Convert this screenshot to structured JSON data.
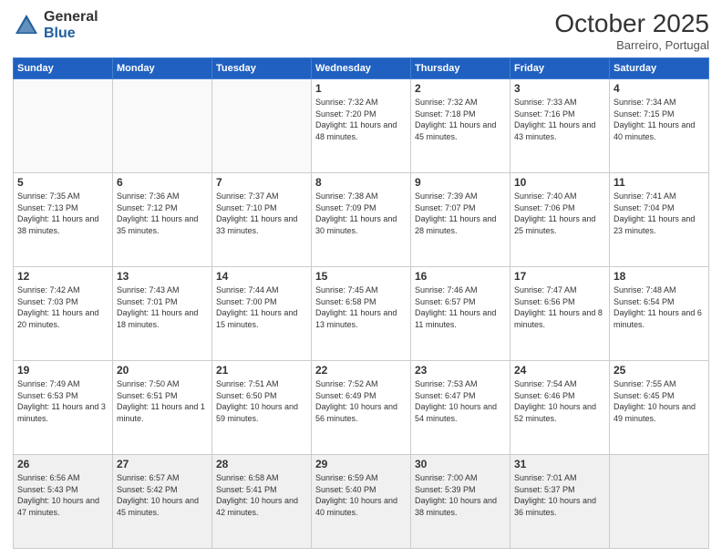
{
  "header": {
    "logo_general": "General",
    "logo_blue": "Blue",
    "month_title": "October 2025",
    "location": "Barreiro, Portugal"
  },
  "days_of_week": [
    "Sunday",
    "Monday",
    "Tuesday",
    "Wednesday",
    "Thursday",
    "Friday",
    "Saturday"
  ],
  "weeks": [
    [
      {
        "day": "",
        "info": ""
      },
      {
        "day": "",
        "info": ""
      },
      {
        "day": "",
        "info": ""
      },
      {
        "day": "1",
        "info": "Sunrise: 7:32 AM\nSunset: 7:20 PM\nDaylight: 11 hours\nand 48 minutes."
      },
      {
        "day": "2",
        "info": "Sunrise: 7:32 AM\nSunset: 7:18 PM\nDaylight: 11 hours\nand 45 minutes."
      },
      {
        "day": "3",
        "info": "Sunrise: 7:33 AM\nSunset: 7:16 PM\nDaylight: 11 hours\nand 43 minutes."
      },
      {
        "day": "4",
        "info": "Sunrise: 7:34 AM\nSunset: 7:15 PM\nDaylight: 11 hours\nand 40 minutes."
      }
    ],
    [
      {
        "day": "5",
        "info": "Sunrise: 7:35 AM\nSunset: 7:13 PM\nDaylight: 11 hours\nand 38 minutes."
      },
      {
        "day": "6",
        "info": "Sunrise: 7:36 AM\nSunset: 7:12 PM\nDaylight: 11 hours\nand 35 minutes."
      },
      {
        "day": "7",
        "info": "Sunrise: 7:37 AM\nSunset: 7:10 PM\nDaylight: 11 hours\nand 33 minutes."
      },
      {
        "day": "8",
        "info": "Sunrise: 7:38 AM\nSunset: 7:09 PM\nDaylight: 11 hours\nand 30 minutes."
      },
      {
        "day": "9",
        "info": "Sunrise: 7:39 AM\nSunset: 7:07 PM\nDaylight: 11 hours\nand 28 minutes."
      },
      {
        "day": "10",
        "info": "Sunrise: 7:40 AM\nSunset: 7:06 PM\nDaylight: 11 hours\nand 25 minutes."
      },
      {
        "day": "11",
        "info": "Sunrise: 7:41 AM\nSunset: 7:04 PM\nDaylight: 11 hours\nand 23 minutes."
      }
    ],
    [
      {
        "day": "12",
        "info": "Sunrise: 7:42 AM\nSunset: 7:03 PM\nDaylight: 11 hours\nand 20 minutes."
      },
      {
        "day": "13",
        "info": "Sunrise: 7:43 AM\nSunset: 7:01 PM\nDaylight: 11 hours\nand 18 minutes."
      },
      {
        "day": "14",
        "info": "Sunrise: 7:44 AM\nSunset: 7:00 PM\nDaylight: 11 hours\nand 15 minutes."
      },
      {
        "day": "15",
        "info": "Sunrise: 7:45 AM\nSunset: 6:58 PM\nDaylight: 11 hours\nand 13 minutes."
      },
      {
        "day": "16",
        "info": "Sunrise: 7:46 AM\nSunset: 6:57 PM\nDaylight: 11 hours\nand 11 minutes."
      },
      {
        "day": "17",
        "info": "Sunrise: 7:47 AM\nSunset: 6:56 PM\nDaylight: 11 hours\nand 8 minutes."
      },
      {
        "day": "18",
        "info": "Sunrise: 7:48 AM\nSunset: 6:54 PM\nDaylight: 11 hours\nand 6 minutes."
      }
    ],
    [
      {
        "day": "19",
        "info": "Sunrise: 7:49 AM\nSunset: 6:53 PM\nDaylight: 11 hours\nand 3 minutes."
      },
      {
        "day": "20",
        "info": "Sunrise: 7:50 AM\nSunset: 6:51 PM\nDaylight: 11 hours\nand 1 minute."
      },
      {
        "day": "21",
        "info": "Sunrise: 7:51 AM\nSunset: 6:50 PM\nDaylight: 10 hours\nand 59 minutes."
      },
      {
        "day": "22",
        "info": "Sunrise: 7:52 AM\nSunset: 6:49 PM\nDaylight: 10 hours\nand 56 minutes."
      },
      {
        "day": "23",
        "info": "Sunrise: 7:53 AM\nSunset: 6:47 PM\nDaylight: 10 hours\nand 54 minutes."
      },
      {
        "day": "24",
        "info": "Sunrise: 7:54 AM\nSunset: 6:46 PM\nDaylight: 10 hours\nand 52 minutes."
      },
      {
        "day": "25",
        "info": "Sunrise: 7:55 AM\nSunset: 6:45 PM\nDaylight: 10 hours\nand 49 minutes."
      }
    ],
    [
      {
        "day": "26",
        "info": "Sunrise: 6:56 AM\nSunset: 5:43 PM\nDaylight: 10 hours\nand 47 minutes."
      },
      {
        "day": "27",
        "info": "Sunrise: 6:57 AM\nSunset: 5:42 PM\nDaylight: 10 hours\nand 45 minutes."
      },
      {
        "day": "28",
        "info": "Sunrise: 6:58 AM\nSunset: 5:41 PM\nDaylight: 10 hours\nand 42 minutes."
      },
      {
        "day": "29",
        "info": "Sunrise: 6:59 AM\nSunset: 5:40 PM\nDaylight: 10 hours\nand 40 minutes."
      },
      {
        "day": "30",
        "info": "Sunrise: 7:00 AM\nSunset: 5:39 PM\nDaylight: 10 hours\nand 38 minutes."
      },
      {
        "day": "31",
        "info": "Sunrise: 7:01 AM\nSunset: 5:37 PM\nDaylight: 10 hours\nand 36 minutes."
      },
      {
        "day": "",
        "info": ""
      }
    ]
  ]
}
